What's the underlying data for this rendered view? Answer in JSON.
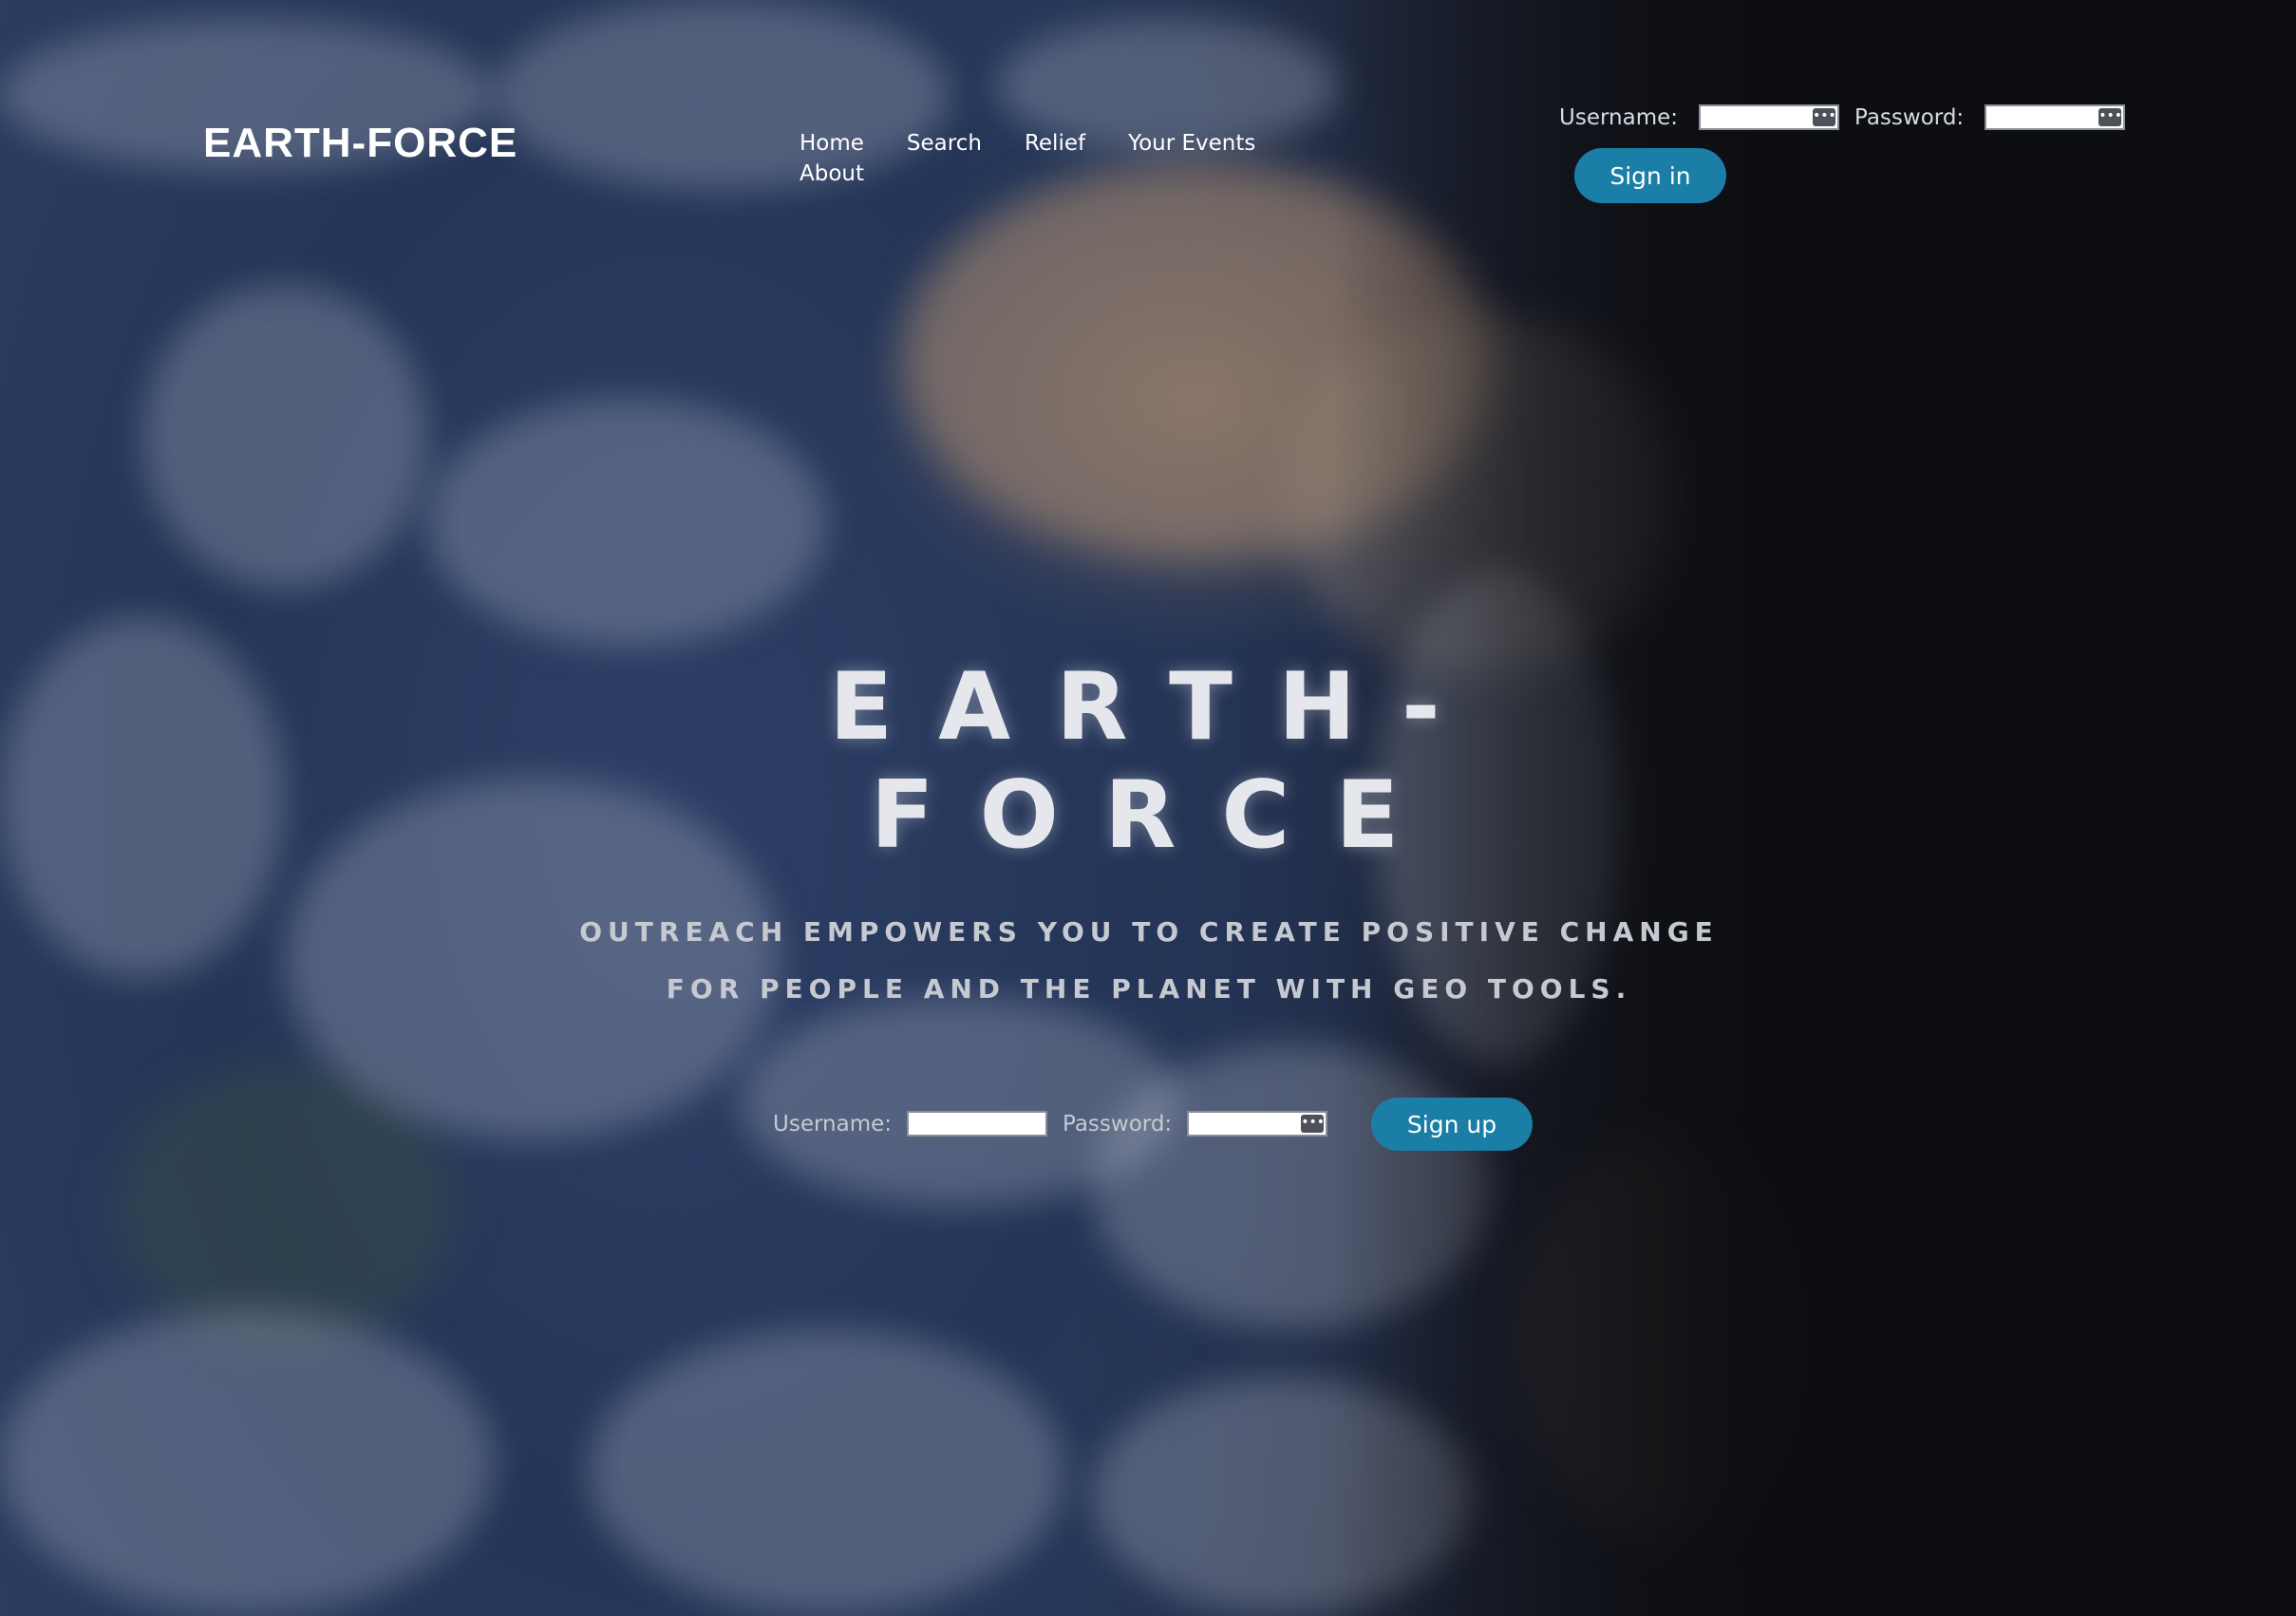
{
  "header": {
    "brand": "EARTH-FORCE",
    "nav": [
      {
        "label": "Home"
      },
      {
        "label": "Search"
      },
      {
        "label": "Relief"
      },
      {
        "label": "Your Events"
      },
      {
        "label": "About"
      }
    ],
    "login": {
      "username_label": "Username:",
      "username_value": "",
      "password_label": "Password:",
      "password_value": "",
      "sign_in_label": "Sign in"
    }
  },
  "hero": {
    "title_line1": "EARTH-",
    "title_line2": "FORCE",
    "subtitle_line1": "OUTREACH EMPOWERS YOU TO CREATE POSITIVE CHANGE",
    "subtitle_line2": "FOR PEOPLE AND THE PLANET WITH GEO TOOLS.",
    "signup": {
      "username_label": "Username:",
      "username_value": "",
      "password_label": "Password:",
      "password_value": "",
      "sign_up_label": "Sign up"
    }
  },
  "icons": {
    "password_manager": "ellipsis-key-icon",
    "password_manager_glyph": "•••"
  },
  "colors": {
    "accent": "#1b7ea6",
    "text": "#ffffff",
    "muted_text": "#c7c9d1",
    "background_dark": "#0d0e12",
    "ocean": "#2b3c60"
  }
}
